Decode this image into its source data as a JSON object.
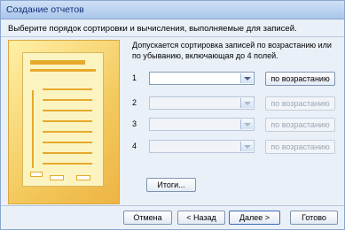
{
  "window": {
    "title": "Создание отчетов"
  },
  "header": {
    "instruction": "Выберите порядок сортировки и вычисления, выполняемые для записей."
  },
  "description": "Допускается сортировка записей по возрастанию или по убыванию, включающая до 4 полей.",
  "sort_rows": [
    {
      "number": "1",
      "value": "",
      "order_label": "по возрастанию",
      "enabled": true
    },
    {
      "number": "2",
      "value": "",
      "order_label": "по возрастанию",
      "enabled": false
    },
    {
      "number": "3",
      "value": "",
      "order_label": "по возрастанию",
      "enabled": false
    },
    {
      "number": "4",
      "value": "",
      "order_label": "по возрастанию",
      "enabled": false
    }
  ],
  "summary_button": "Итоги...",
  "footer": {
    "cancel": "Отмена",
    "back": "< Назад",
    "next": "Далее >",
    "finish": "Готово"
  },
  "colors": {
    "accent": "#e7a92c",
    "title_bg": "#a9c6ec",
    "window_bg": "#eaf0f8"
  }
}
